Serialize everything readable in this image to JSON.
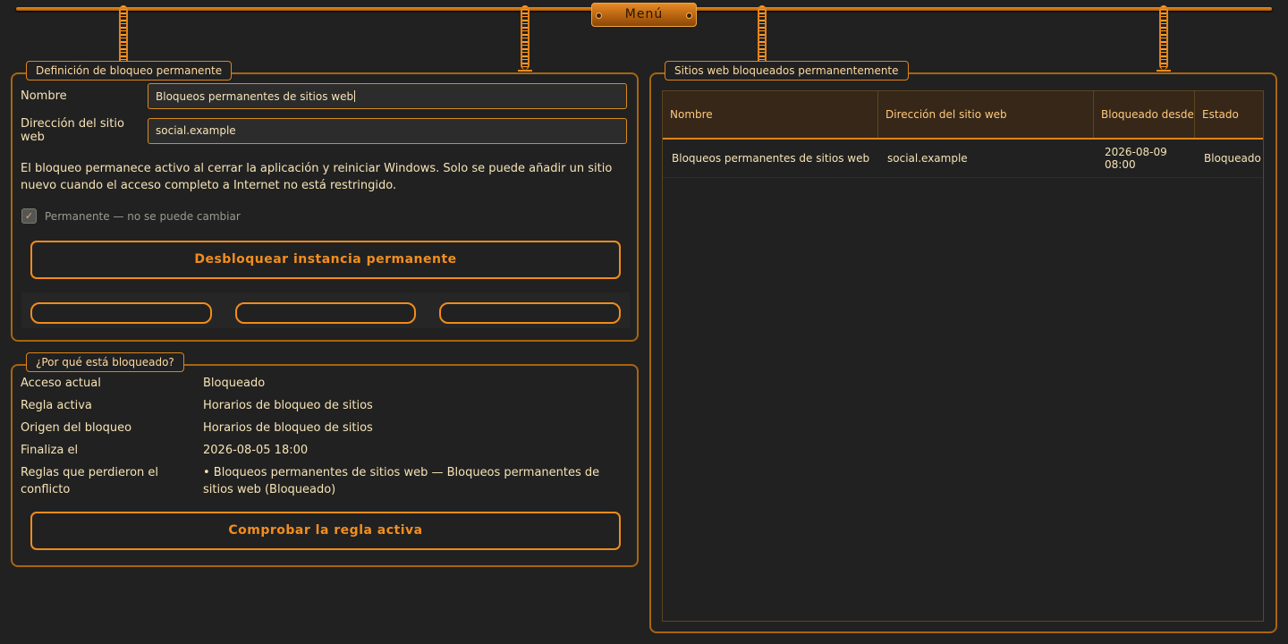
{
  "menu": {
    "label": "Menú"
  },
  "definition": {
    "title": "Definición de bloqueo permanente",
    "name_label": "Nombre",
    "name_value": "Bloqueos permanentes de sitios web",
    "address_label": "Dirección del sitio web",
    "address_value": "social.example",
    "info_text": "El bloqueo permanece activo al cerrar la aplicación y reiniciar Windows. Solo se puede añadir un sitio nuevo cuando el acceso completo a Internet no está restringido.",
    "permanent_checkbox": {
      "label": "Permanente — no se puede cambiar",
      "checked": true,
      "check_glyph": "✓"
    },
    "unblock_button": "Desbloquear instancia permanente"
  },
  "reason": {
    "title": "¿Por qué está bloqueado?",
    "rows": [
      {
        "key": "Acceso actual",
        "value": "Bloqueado"
      },
      {
        "key": "Regla activa",
        "value": "Horarios de bloqueo de sitios"
      },
      {
        "key": "Origen del bloqueo",
        "value": "Horarios de bloqueo de sitios"
      },
      {
        "key": "Finaliza el",
        "value": "2026-08-05 18:00"
      },
      {
        "key": "Reglas que perdieron el conflicto",
        "value": "• Bloqueos permanentes de sitios web — Bloqueos permanentes de sitios web (Bloqueado)"
      }
    ],
    "check_button": "Comprobar la regla activa"
  },
  "blocked_sites": {
    "title": "Sitios web bloqueados permanentemente",
    "columns": [
      "Nombre",
      "Dirección del sitio web",
      "Bloqueado desde",
      "Estado"
    ],
    "rows": [
      [
        "Bloqueos permanentes de sitios web",
        "social.example",
        "2026-08-09 08:00",
        "Bloqueado"
      ]
    ]
  },
  "colors": {
    "accent": "#f08c1c",
    "background": "#212121",
    "text": "#f6e3b6",
    "header_text": "#ffc97e"
  }
}
